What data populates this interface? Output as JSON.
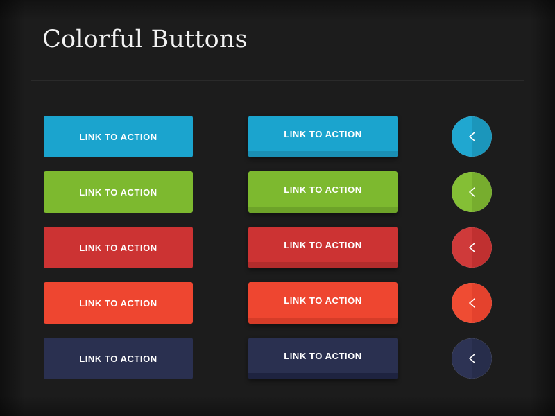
{
  "page": {
    "title": "Colorful Buttons",
    "background_color": "#1c1c1c",
    "title_color": "#f2f2f2",
    "divider_color": "#2a2a2a"
  },
  "button_label": "LINK TO ACTION",
  "circle_icon_name": "chevron-left-icon",
  "columns": [
    {
      "id": "flat",
      "style": "flat"
    },
    {
      "id": "bevel",
      "style": "beveled"
    },
    {
      "id": "circle",
      "style": "circular"
    }
  ],
  "rows": [
    {
      "name": "blue",
      "flat": {
        "label": "LINK TO ACTION",
        "color": "#1ba4ce"
      },
      "bevel": {
        "label": "LINK TO ACTION",
        "color": "#1ba4ce",
        "bevel_color": "#1a8fb4"
      },
      "circle": {
        "color_left": "#20a7d0",
        "color_right": "#1b96bb",
        "icon": "chevron-left-icon"
      }
    },
    {
      "name": "green",
      "flat": {
        "label": "LINK TO ACTION",
        "color": "#7db92f"
      },
      "bevel": {
        "label": "LINK TO ACTION",
        "color": "#7db92f",
        "bevel_color": "#6da329"
      },
      "circle": {
        "color_left": "#84bf35",
        "color_right": "#77ad2e",
        "icon": "chevron-left-icon"
      }
    },
    {
      "name": "red",
      "flat": {
        "label": "LINK TO ACTION",
        "color": "#cc3333"
      },
      "bevel": {
        "label": "LINK TO ACTION",
        "color": "#cc3333",
        "bevel_color": "#b32c2c"
      },
      "circle": {
        "color_left": "#cf3a3a",
        "color_right": "#c03030",
        "icon": "chevron-left-icon"
      }
    },
    {
      "name": "orange",
      "flat": {
        "label": "LINK TO ACTION",
        "color": "#ee4630"
      },
      "bevel": {
        "label": "LINK TO ACTION",
        "color": "#ee4630",
        "bevel_color": "#d63c28"
      },
      "circle": {
        "color_left": "#ef4c33",
        "color_right": "#e4422d",
        "icon": "chevron-left-icon"
      }
    },
    {
      "name": "navy",
      "flat": {
        "label": "LINK TO ACTION",
        "color": "#2a3050"
      },
      "bevel": {
        "label": "LINK TO ACTION",
        "color": "#2a3050",
        "bevel_color": "#1e2340"
      },
      "circle": {
        "color_left": "#2d3354",
        "color_right": "#272d4b",
        "icon": "chevron-left-icon"
      }
    }
  ]
}
